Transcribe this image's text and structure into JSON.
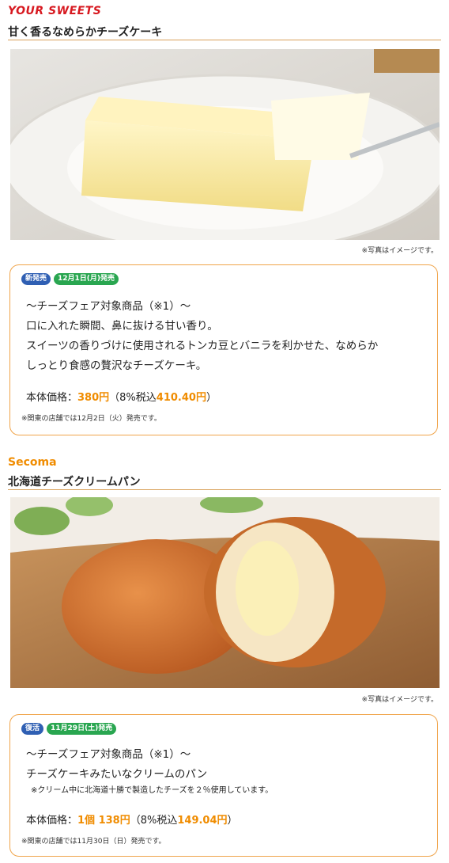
{
  "items": [
    {
      "brand": "YOUR SWEETS",
      "title": "甘く香るなめらかチーズケーキ",
      "photo_caption": "※写真はイメージです。",
      "badges": [
        "新発売",
        "12月1日(月)発売"
      ],
      "lines": [
        "〜チーズフェア対象商品（※1）〜",
        "口に入れた瞬間、鼻に抜ける甘い香り。",
        "スイーツの香りづけに使用されるトンカ豆とバニラを利かせた、なめらか",
        "しっとり食感の贅沢なチーズケーキ。"
      ],
      "price_label": "本体価格：",
      "price_value": "380円",
      "tax_prefix": "（8%税込",
      "tax_value": "410.40円",
      "tax_suffix": "）",
      "note": "※関東の店舗では12月2日（火）発売です。"
    },
    {
      "brand": "Secoma",
      "title": "北海道チーズクリームパン",
      "photo_caption": "※写真はイメージです。",
      "badges": [
        "復活",
        "11月29日(土)発売"
      ],
      "lines": [
        "〜チーズフェア対象商品（※1）〜",
        "チーズケーキみたいなクリームのパン"
      ],
      "subnote": "※クリーム中に北海道十勝で製造したチーズを２％使用しています。",
      "price_label": "本体価格：",
      "price_value": "1個 138円",
      "tax_prefix": "（8%税込",
      "tax_value": "149.04円",
      "tax_suffix": "）",
      "note": "※関東の店舗では11月30日（日）発売です。"
    }
  ]
}
